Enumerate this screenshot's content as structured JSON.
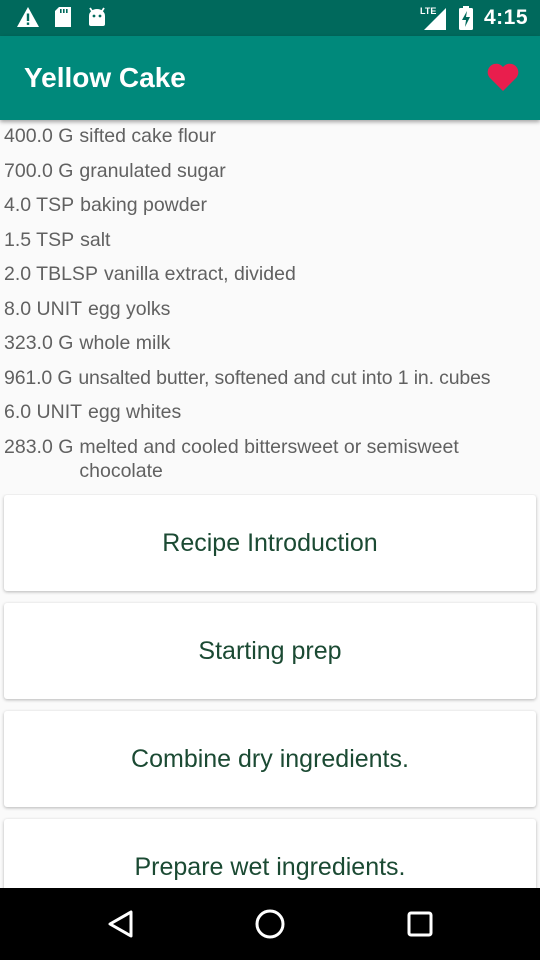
{
  "status_bar": {
    "time": "4:15",
    "network": "LTE",
    "icons": [
      "warning-icon",
      "sd-card-icon",
      "android-icon",
      "signal-icon",
      "battery-charging-icon"
    ]
  },
  "app_bar": {
    "title": "Yellow Cake",
    "favorite_icon": "heart-icon",
    "favorite_color": "#e91e4d"
  },
  "ingredients": [
    {
      "quantity": "400.0 G",
      "name": "sifted cake flour"
    },
    {
      "quantity": "700.0 G",
      "name": "granulated sugar"
    },
    {
      "quantity": "4.0 TSP",
      "name": "baking powder"
    },
    {
      "quantity": "1.5 TSP",
      "name": "salt"
    },
    {
      "quantity": "2.0 TBLSP",
      "name": "vanilla extract, divided"
    },
    {
      "quantity": "8.0 UNIT",
      "name": "egg yolks"
    },
    {
      "quantity": "323.0 G",
      "name": "whole milk"
    },
    {
      "quantity": "961.0 G",
      "name": "unsalted butter, softened and cut into 1 in. cubes"
    },
    {
      "quantity": "6.0 UNIT",
      "name": "egg whites"
    },
    {
      "quantity": "283.0 G",
      "name": "melted and cooled bittersweet or semisweet chocolate"
    }
  ],
  "steps": [
    "Recipe Introduction",
    "Starting prep",
    "Combine dry ingredients.",
    "Prepare wet ingredients."
  ],
  "colors": {
    "status_bar": "#00695c",
    "app_bar": "#00897b",
    "step_text": "#1b4a33",
    "ingredient_text": "#616161"
  },
  "nav_bar": {
    "icons": [
      "back-icon",
      "home-icon",
      "recents-icon"
    ]
  }
}
